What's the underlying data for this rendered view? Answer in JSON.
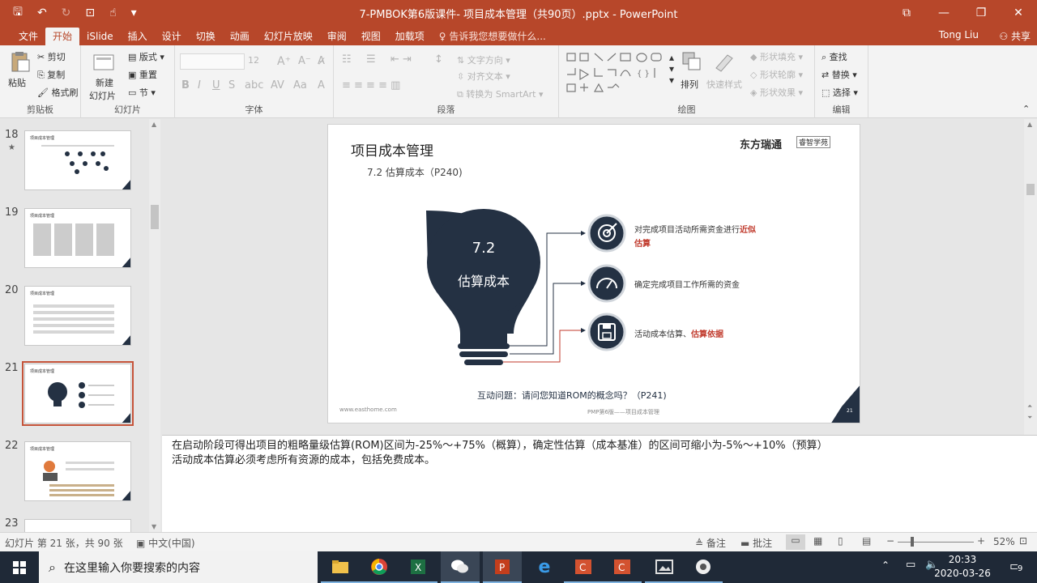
{
  "window": {
    "title": "7-PMBOK第6版课件- 项目成本管理（共90页）.pptx - PowerPoint",
    "user": "Tong Liu",
    "share": "共享"
  },
  "tabs": [
    "文件",
    "开始",
    "iSlide",
    "插入",
    "设计",
    "切换",
    "动画",
    "幻灯片放映",
    "审阅",
    "视图",
    "加载项"
  ],
  "tell_me": "告诉我您想要做什么...",
  "ribbon": {
    "clipboard": {
      "label": "剪贴板",
      "paste": "粘贴",
      "cut": "剪切",
      "copy": "复制",
      "format_painter": "格式刷"
    },
    "slides": {
      "label": "幻灯片",
      "new_slide": "新建",
      "new_slide2": "幻灯片",
      "layout": "版式",
      "reset": "重置",
      "section": "节"
    },
    "font": {
      "label": "字体",
      "size": "12"
    },
    "paragraph": {
      "label": "段落",
      "text_direction": "文字方向",
      "align_text": "对齐文本",
      "smartart": "转换为 SmartArt"
    },
    "drawing": {
      "label": "绘图",
      "arrange": "排列",
      "quick_styles": "快速样式",
      "shape_fill": "形状填充",
      "shape_outline": "形状轮廓",
      "shape_effects": "形状效果"
    },
    "editing": {
      "label": "编辑",
      "find": "查找",
      "replace": "替换",
      "select": "选择"
    }
  },
  "thumbnails": [
    {
      "num": "18",
      "star": "★",
      "title": "项目成本管理"
    },
    {
      "num": "19",
      "star": "",
      "title": "项目成本管理"
    },
    {
      "num": "20",
      "star": "",
      "title": "项目成本管理"
    },
    {
      "num": "21",
      "star": "",
      "title": "项目成本管理"
    },
    {
      "num": "22",
      "star": "",
      "title": "项目成本管理"
    },
    {
      "num": "23",
      "star": "",
      "title": ""
    }
  ],
  "slide": {
    "title": "项目成本管理",
    "subtitle": "7.2 估算成本（P240)",
    "logo": "东方瑞通",
    "logo_tag": "睿智学苑",
    "bulb_number": "7.2",
    "bulb_text": "估算成本",
    "items": [
      {
        "text_pre": "对完成项目活动所需资金进行",
        "text_em": "近似",
        "text_line2": "估算",
        "icon": "target-icon"
      },
      {
        "text_pre": "确定完成项目工作所需的资金",
        "text_em": "",
        "text_line2": "",
        "icon": "gauge-icon"
      },
      {
        "text_pre": "活动成本估算、",
        "text_em": "估算依据",
        "text_line2": "",
        "icon": "floppy-icon"
      }
    ],
    "question": "互动问题：请问您知道ROM的概念吗？（P241)",
    "website": "www.easthome.com",
    "footer": "PMP第6版——项目成本管理",
    "page_no": "21"
  },
  "notes": {
    "line1": "在启动阶段可得出项目的粗略量级估算(ROM)区间为-25%～+75%（概算），确定性估算（成本基准）的区间可缩小为-5%～+10%（预算）",
    "line2": "活动成本估算必须考虑所有资源的成本，包括免费成本。"
  },
  "status": {
    "slide_info": "幻灯片 第 21 张，共 90 张",
    "language": "中文(中国)",
    "notes_btn": "备注",
    "comments_btn": "批注",
    "zoom": "52%"
  },
  "taskbar": {
    "search_placeholder": "在这里输入你要搜索的内容",
    "time": "20:33",
    "date": "2020-03-26",
    "notifications": "9"
  },
  "colors": {
    "accent": "#b7472a",
    "bulb": "#243143",
    "emphasis": "#c0392b"
  }
}
